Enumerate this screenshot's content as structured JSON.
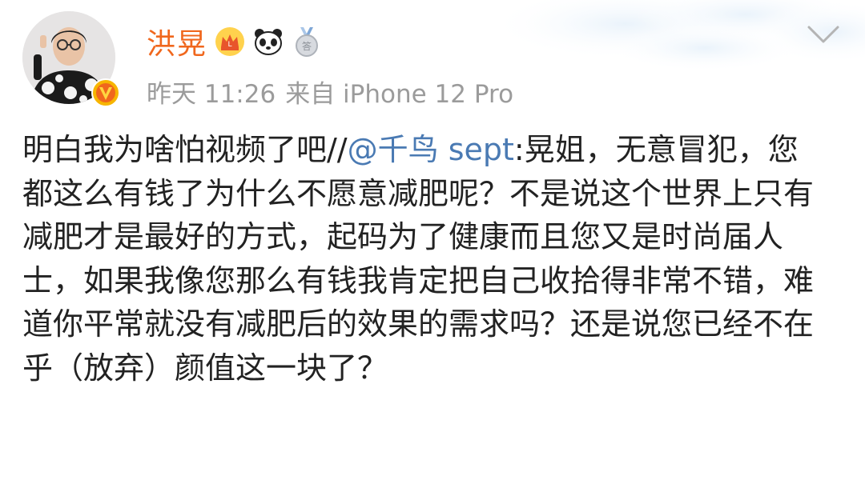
{
  "user": {
    "name": "洪晃",
    "badges": [
      "crown-badge",
      "panda-badge",
      "medal-badge"
    ],
    "verified_icon": "v-verified-icon"
  },
  "meta": {
    "time": "昨天 11:26",
    "source": "来自 iPhone 12 Pro"
  },
  "post": {
    "text_before": "明白我为啥怕视频了吧//",
    "mention": "@千鸟 sept",
    "text_after": ":晃姐，无意冒犯，您都这么有钱了为什么不愿意减肥呢？不是说这个世界上只有减肥才是最好的方式，起码为了健康而且您又是时尚届人士，如果我像您那么有钱我肯定把自己收拾得非常不错，难道你平常就没有减肥后的效果的需求吗？还是说您已经不在乎（放弃）颜值这一块了？"
  },
  "colors": {
    "name": "#f0671d",
    "mention": "#4a7ab3",
    "meta": "#9b9b9b",
    "text": "#222222"
  },
  "icons": {
    "more": "chevron-down-icon"
  }
}
